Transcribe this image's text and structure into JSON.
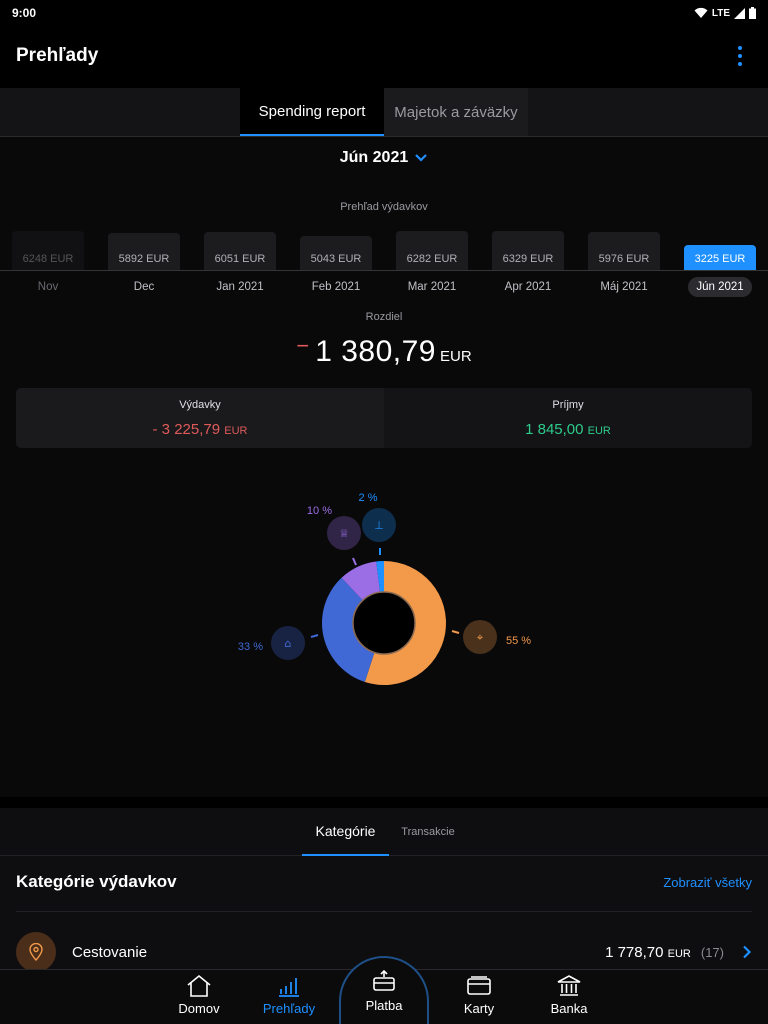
{
  "status": {
    "time": "9:00",
    "network": "LTE"
  },
  "header": {
    "title": "Prehľady"
  },
  "top_tabs": [
    {
      "label": "Spending report"
    },
    {
      "label": "Majetok a záväzky"
    }
  ],
  "month_selector": {
    "label": "Jún 2021"
  },
  "overview_label": "Prehľad výdavkov",
  "chart_data": {
    "type": "bar",
    "title": "",
    "categories": [
      "Nov",
      "Dec",
      "Jan 2021",
      "Feb 2021",
      "Mar 2021",
      "Apr 2021",
      "Máj 2021",
      "Jún 2021"
    ],
    "values": [
      6248,
      5892,
      6051,
      5043,
      6282,
      6329,
      5976,
      3225
    ],
    "value_labels": [
      "6248 EUR",
      "5892 EUR",
      "6051 EUR",
      "5043 EUR",
      "6282 EUR",
      "6329 EUR",
      "5976 EUR",
      "3225 EUR"
    ],
    "selected": "Jún 2021",
    "unit": "EUR",
    "grid": false
  },
  "difference": {
    "label": "Rozdiel",
    "sign": "−",
    "value": "1 380,79",
    "currency": "EUR"
  },
  "summary": {
    "expenses": {
      "label": "Výdavky",
      "amount": "- 3 225,79",
      "currency": "EUR"
    },
    "income": {
      "label": "Príjmy",
      "amount": "1 845,00",
      "currency": "EUR"
    }
  },
  "donut": {
    "segments": [
      {
        "percent": 55,
        "label": "55 %",
        "color": "#f2994a",
        "icon": "location-pin-icon"
      },
      {
        "percent": 33,
        "label": "33 %",
        "color": "#4169d6",
        "icon": "home-icon"
      },
      {
        "percent": 10,
        "label": "10 %",
        "color": "#9b6ee6",
        "icon": "chef-hat-icon"
      },
      {
        "percent": 2,
        "label": "2 %",
        "color": "#1e90ff",
        "icon": "pipe-icon"
      }
    ]
  },
  "sub_tabs": [
    {
      "label": "Kategórie"
    },
    {
      "label": "Transakcie"
    }
  ],
  "categories_section": {
    "title": "Kategórie výdavkov",
    "link": "Zobraziť všetky",
    "items": [
      {
        "name": "Cestovanie",
        "amount": "1 778,70",
        "currency": "EUR",
        "count": "(17)",
        "icon": "location-pin-icon"
      }
    ]
  },
  "bottom_nav": [
    {
      "label": "Domov",
      "icon": "home-icon"
    },
    {
      "label": "Prehľady",
      "icon": "bar-chart-icon"
    },
    {
      "label": "Platba",
      "icon": "payment-icon"
    },
    {
      "label": "Karty",
      "icon": "cards-icon"
    },
    {
      "label": "Banka",
      "icon": "bank-icon"
    }
  ],
  "colors": {
    "accent": "#1e90ff",
    "negative": "#e05a5a",
    "positive": "#2ecc8b"
  }
}
